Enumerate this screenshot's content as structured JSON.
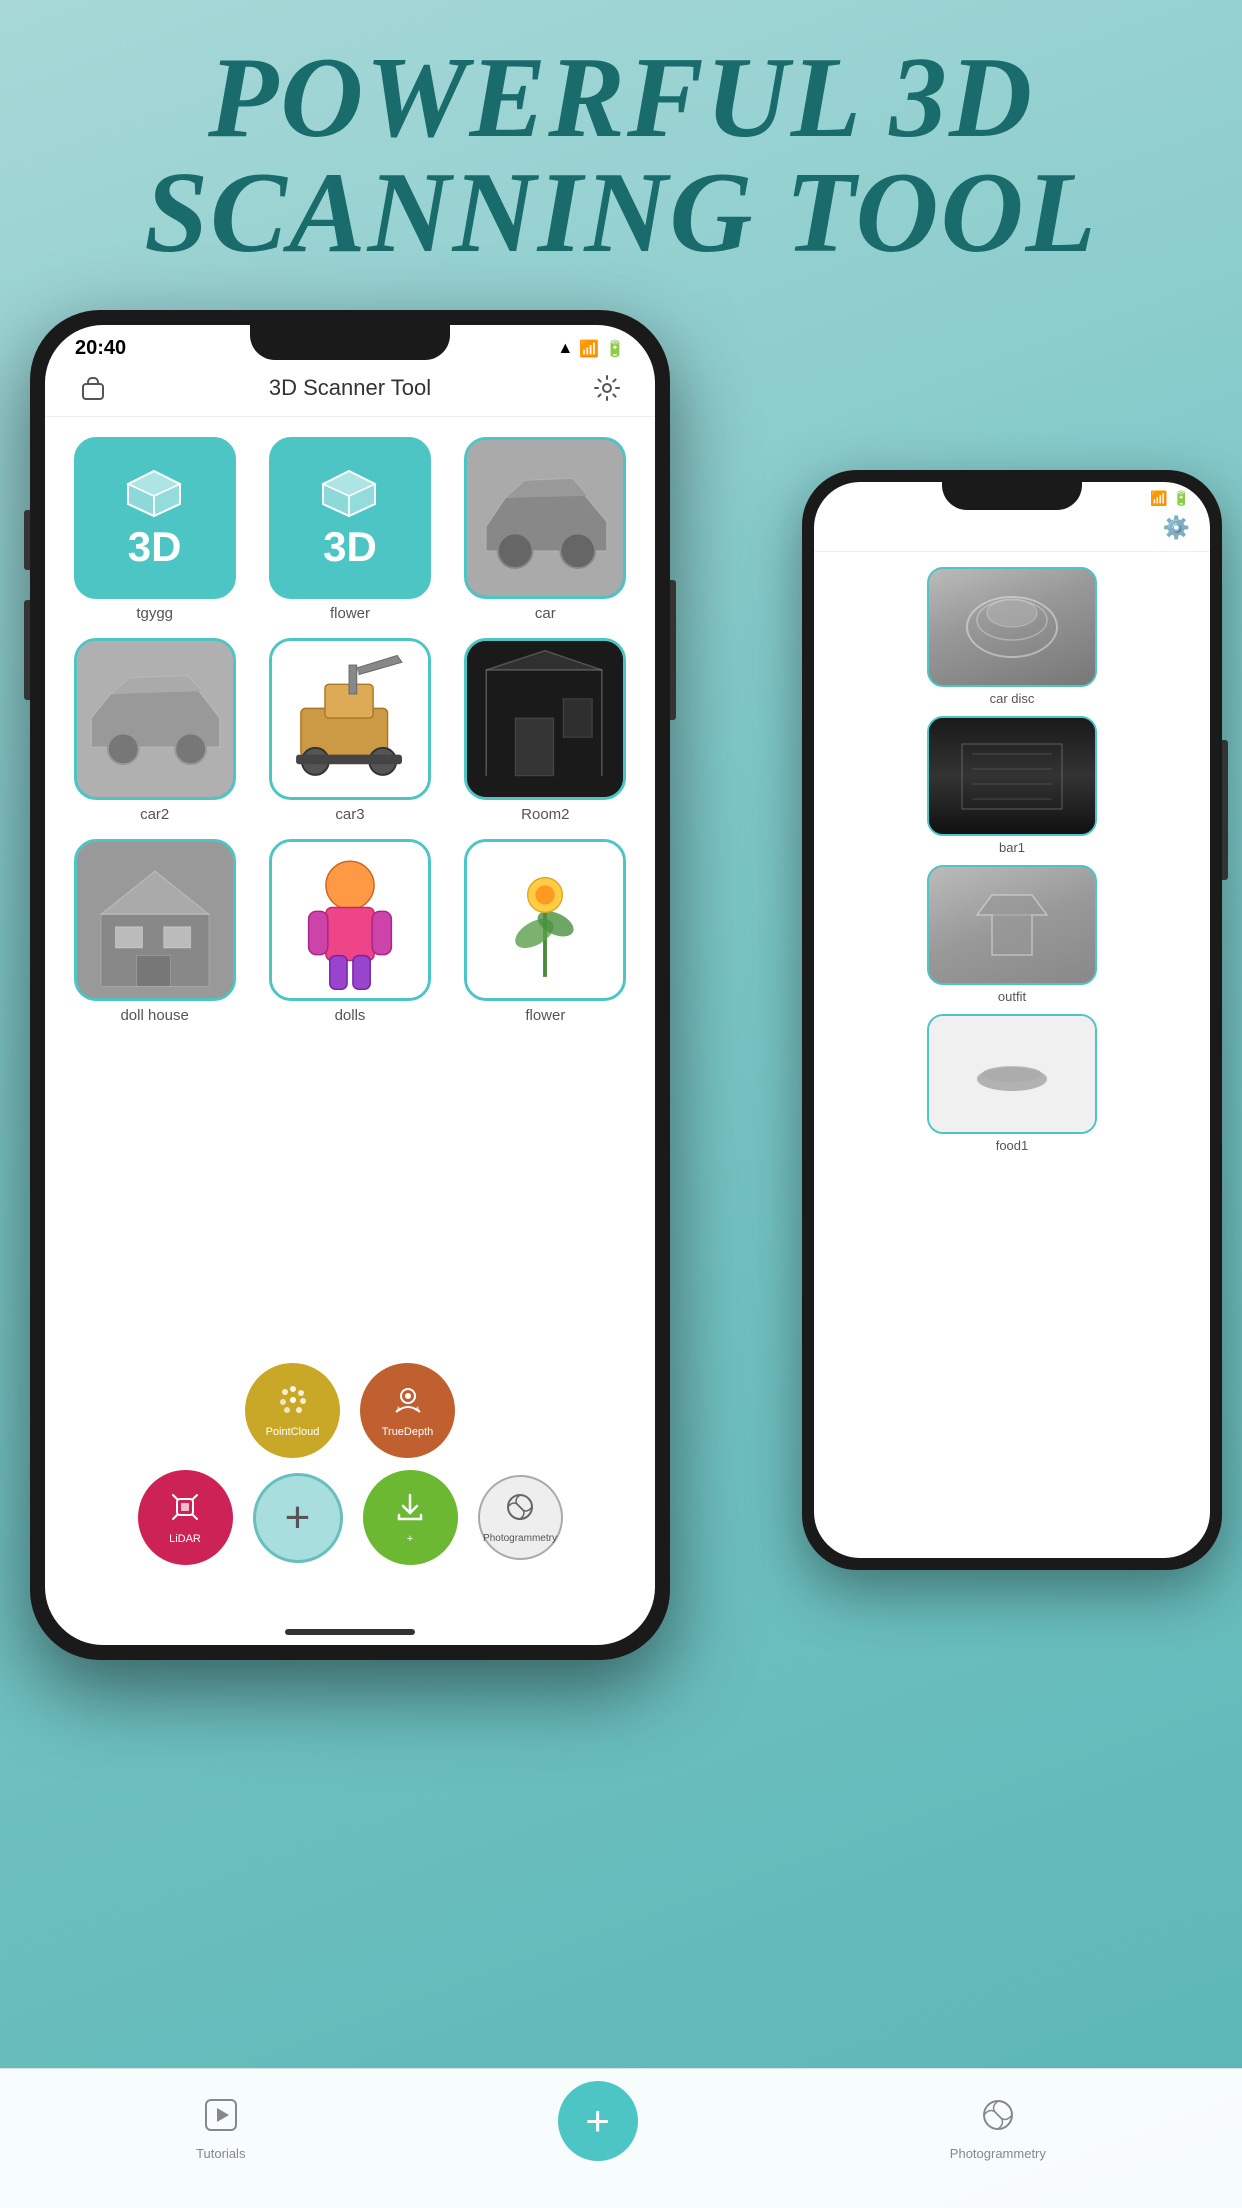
{
  "header": {
    "line1": "POWERFUL 3D",
    "line2": "SCANNING TOOL"
  },
  "main_phone": {
    "status": {
      "time": "20:40",
      "icons": "▲ ● ▬"
    },
    "nav": {
      "title": "3D Scanner Tool",
      "left_icon": "bag",
      "right_icon": "gear"
    },
    "grid_items": [
      {
        "id": "tgygg",
        "label": "tgygg",
        "type": "3d_teal"
      },
      {
        "id": "flower",
        "label": "flower",
        "type": "3d_teal"
      },
      {
        "id": "car",
        "label": "car",
        "type": "gray_scan"
      },
      {
        "id": "car2",
        "label": "car2",
        "type": "gray_scan_2"
      },
      {
        "id": "car3",
        "label": "car3",
        "type": "white_scan"
      },
      {
        "id": "room2",
        "label": "Room2",
        "type": "dark_scan"
      },
      {
        "id": "doll_house",
        "label": "doll house",
        "type": "gray_scan_3"
      },
      {
        "id": "dolls",
        "label": "dolls",
        "type": "color_scan"
      },
      {
        "id": "flower2",
        "label": "flower",
        "type": "white_scan_2"
      }
    ],
    "fab_buttons": [
      {
        "id": "pointcloud",
        "label": "PointCloud",
        "color": "#c8a826"
      },
      {
        "id": "truedepth",
        "label": "TrueDepth",
        "color": "#c06030"
      },
      {
        "id": "lidar",
        "label": "LiDAR",
        "color": "#cc2255"
      },
      {
        "id": "add",
        "label": "+",
        "color": "#a8dede"
      },
      {
        "id": "import",
        "label": "Import",
        "color": "#6cb833"
      },
      {
        "id": "photogrammetry",
        "label": "Photogrammetry",
        "color": "transparent"
      }
    ],
    "tab_bar": [
      {
        "id": "tutorials",
        "label": "Tutorials",
        "icon": "▶"
      },
      {
        "id": "add_center",
        "label": "+",
        "center": true
      },
      {
        "id": "photogrammetry",
        "label": "Photogrammetry",
        "icon": "🔄"
      }
    ]
  },
  "secondary_phone": {
    "nav": {
      "right_icon": "gear"
    },
    "grid_items": [
      {
        "id": "car_disc",
        "label": "car disc",
        "type": "cardisc"
      },
      {
        "id": "bar1",
        "label": "bar1",
        "type": "bar1"
      },
      {
        "id": "outfit",
        "label": "outfit",
        "type": "outfit"
      },
      {
        "id": "food1",
        "label": "food1",
        "type": "food1"
      }
    ]
  },
  "colors": {
    "teal": "#4ec5c5",
    "teal_dark": "#1a6b6b",
    "background_start": "#a8d8d8",
    "background_end": "#5ab5b5"
  }
}
